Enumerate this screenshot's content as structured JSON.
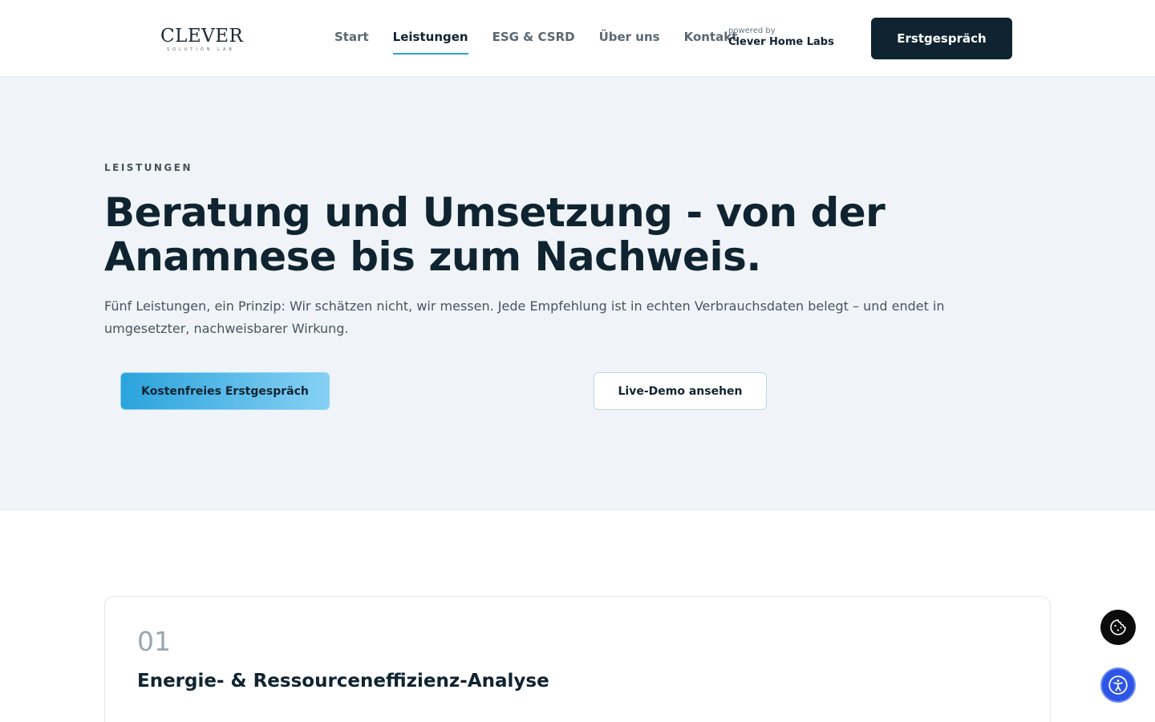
{
  "header": {
    "logo": {
      "main": "CLEVER",
      "sub": "SOLUTION LAB"
    },
    "nav": [
      {
        "label": "Start",
        "active": false
      },
      {
        "label": "Leistungen",
        "active": true
      },
      {
        "label": "ESG & CSRD",
        "active": false
      },
      {
        "label": "Über uns",
        "active": false
      },
      {
        "label": "Kontakt",
        "active": false
      }
    ],
    "powered_by": "powered by",
    "powered_name": "Clever Home Labs",
    "cta_label": "Erstgespräch"
  },
  "hero": {
    "eyebrow": "LEISTUNGEN",
    "headline": "Beratung und Umsetzung - von der Anamnese bis zum Nachweis.",
    "lead": "Fünf Leistungen, ein Prinzip: Wir schätzen nicht, wir messen. Jede Empfehlung ist in echten Verbrauchsdaten belegt – und endet in umgesetzter, nachweisbarer Wirkung.",
    "primary_cta": "Kostenfreies Erstgespräch",
    "secondary_cta": "Live-Demo ansehen"
  },
  "services": [
    {
      "number": "01",
      "title": "Energie- & Ressourceneffizienz-Analyse"
    }
  ],
  "floating": {
    "cookie_icon": "cookie-icon",
    "accessibility_icon": "accessibility-icon"
  },
  "colors": {
    "brand_dark": "#0f2430",
    "accent": "#2aa3dc",
    "hero_bg": "#f0f4f8",
    "accessibility_blue": "#2d55e6"
  }
}
